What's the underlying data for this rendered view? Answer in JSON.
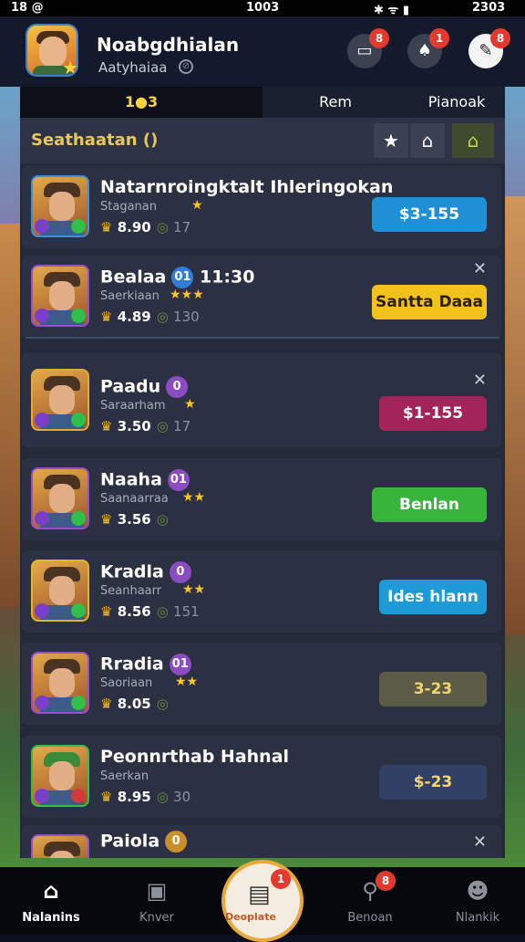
{
  "status_bar": {
    "left": "18 @",
    "time": "1003",
    "right": "2303"
  },
  "header": {
    "player_name": "Noabgdhialan",
    "player_subtitle": "Aatyhaiaa",
    "buttons": [
      {
        "icon": "inbox-icon",
        "badge": "8"
      },
      {
        "icon": "bell-icon",
        "badge": "1"
      },
      {
        "icon": "feather-icon",
        "badge": "8"
      }
    ]
  },
  "tabs": [
    {
      "label": "1●3",
      "active": true
    },
    {
      "label": "Rem",
      "active": false
    },
    {
      "label": "Pianoak",
      "active": false
    }
  ],
  "panel": {
    "title": "Seathaatan ()",
    "filters": [
      "star-icon",
      "home-icon",
      "house-icon"
    ]
  },
  "rows": [
    {
      "name": "Natarnroingktalt Ihleringokan",
      "subtitle": "Staganan",
      "stars": "★",
      "score": "8.90",
      "count": "17",
      "action": "$3-155",
      "action_color": "#1f8fd6",
      "action_text_color": "#ffffff",
      "closable": false
    },
    {
      "name": "Bealaa",
      "level": "01",
      "time": "11:30",
      "subtitle": "Saerkiaan",
      "stars": "★★★",
      "score": "4.89",
      "count": "130",
      "action": "Santta Daaa",
      "action_color": "#f0c21a",
      "action_text_color": "#2a2000",
      "closable": true
    },
    {
      "name": "Paadu",
      "level": "0",
      "subtitle": "Saraarham",
      "stars": "★",
      "score": "3.50",
      "count": "17",
      "action": "$1-155",
      "action_color": "#a3245a",
      "action_text_color": "#ffffff",
      "closable": true
    },
    {
      "name": "Naaha",
      "level": "01",
      "subtitle": "Saanaarraa",
      "stars": "★★",
      "score": "3.56",
      "count": "",
      "action": "Benlan",
      "action_color": "#36b53a",
      "action_text_color": "#ffffff",
      "closable": false
    },
    {
      "name": "Kradla",
      "level": "0",
      "subtitle": "Seanhaarr",
      "stars": "★★",
      "score": "8.56",
      "count": "151",
      "action": "Ides hlann",
      "action_color": "#1e9ad6",
      "action_text_color": "#ffffff",
      "closable": false
    },
    {
      "name": "Rradia",
      "level": "01",
      "subtitle": "Saoriaan",
      "stars": "★★",
      "score": "8.05",
      "count": "",
      "action": "3-23",
      "action_color": "#5c5b46",
      "action_text_color": "#f2d56a",
      "closable": false
    },
    {
      "name": "Peonnrthab Hahnal",
      "level": "",
      "subtitle": "Saerkan",
      "stars": "",
      "score": "8.95",
      "count": "30",
      "action": "$-23",
      "action_color": "#334066",
      "action_text_color": "#f2d56a",
      "closable": false
    },
    {
      "name": "Paiola",
      "level": "0",
      "subtitle": "",
      "stars": "",
      "score": "",
      "count": "",
      "action": "",
      "action_color": "",
      "action_text_color": "",
      "closable": true
    }
  ],
  "nav": [
    {
      "label": "Nalanins",
      "icon": "home-icon"
    },
    {
      "label": "Knver",
      "icon": "store-icon"
    },
    {
      "label": "Deoplate",
      "icon": "chest-icon",
      "badge": "1"
    },
    {
      "label": "Benoan",
      "icon": "search-icon",
      "badge": "8"
    },
    {
      "label": "Nlankik",
      "icon": "profile-icon"
    }
  ]
}
